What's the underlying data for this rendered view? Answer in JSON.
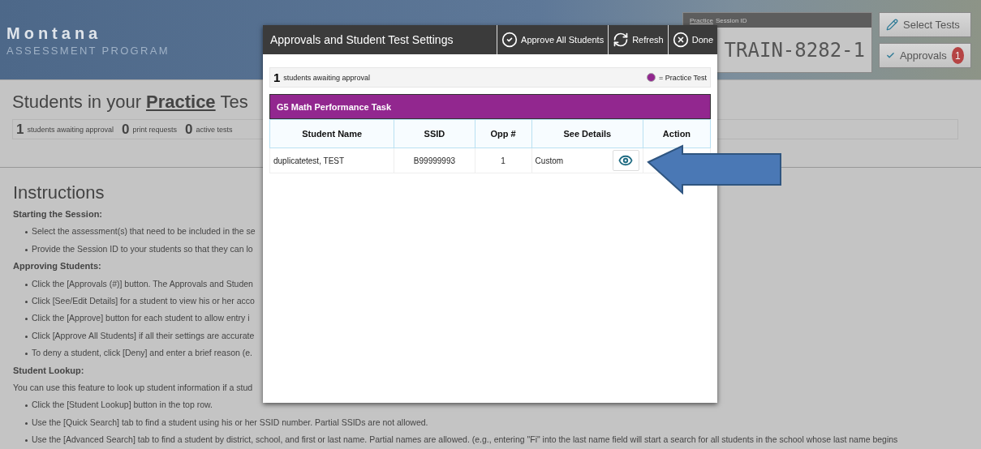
{
  "header": {
    "brand_title": "Montana",
    "brand_subtitle": "ASSESSMENT PROGRAM",
    "session": {
      "label_link": "Practice",
      "label_rest": "Session ID",
      "id": "TRAIN-8282-1"
    },
    "buttons": [
      {
        "kind": "pencil",
        "label": "Select Tests"
      },
      {
        "kind": "check",
        "label": "Approvals",
        "badge": "1"
      }
    ]
  },
  "page_title": {
    "prefix": "Students in your",
    "emphasis": "Practice",
    "suffix": "Tes"
  },
  "stats": [
    {
      "count": "1",
      "label": "students awaiting approval"
    },
    {
      "count": "0",
      "label": "print requests"
    },
    {
      "count": "0",
      "label": "active tests"
    }
  ],
  "instructions": {
    "heading": "Instructions",
    "sections": [
      {
        "heading": "Starting the Session:",
        "items": [
          "Select the assessment(s) that need to be included in the se",
          "Provide the Session ID to your students so that they can lo"
        ]
      },
      {
        "heading": "Approving Students:",
        "items": [
          "Click the [Approvals (#)] button. The Approvals and Studen",
          "Click [See/Edit Details] for a student to view his or her acco",
          "Click the [Approve] button for each student to allow entry i",
          "Click [Approve All Students] if all their settings are accurate",
          "To deny a student, click [Deny] and enter a brief reason (e."
        ]
      },
      {
        "heading": "Student Lookup:",
        "intro": "You can use this feature to look up student information if a stud",
        "items": [
          "Click the [Student Lookup] button in the top row.",
          "Use the [Quick Search] tab to find a student using his or her SSID number. Partial SSIDs are not allowed.",
          "Use the [Advanced Search] tab to find a student by district, school, and first or last name. Partial names are allowed. (e.g., entering \"Fi\" into the last name field will start a search for all students in the school whose last name begins"
        ]
      }
    ]
  },
  "modal": {
    "title": "Approvals and Student Test Settings",
    "actions": [
      {
        "kind": "approve",
        "label": "Approve All Students"
      },
      {
        "kind": "refresh",
        "label": "Refresh"
      },
      {
        "kind": "close",
        "label": "Done"
      }
    ],
    "awaiting": {
      "count": "1",
      "label": "students awaiting approval"
    },
    "legend": {
      "color": "#92278f",
      "label": "= Practice Test"
    },
    "test": {
      "name": "G5 Math Performance Task",
      "color": "#92278f",
      "columns": [
        "Student Name",
        "SSID",
        "Opp #",
        "See Details",
        "Action"
      ],
      "rows": [
        {
          "student_name": "duplicatetest, TEST",
          "ssid": "B99999993",
          "opp": "1",
          "details": "Custom"
        }
      ]
    }
  }
}
